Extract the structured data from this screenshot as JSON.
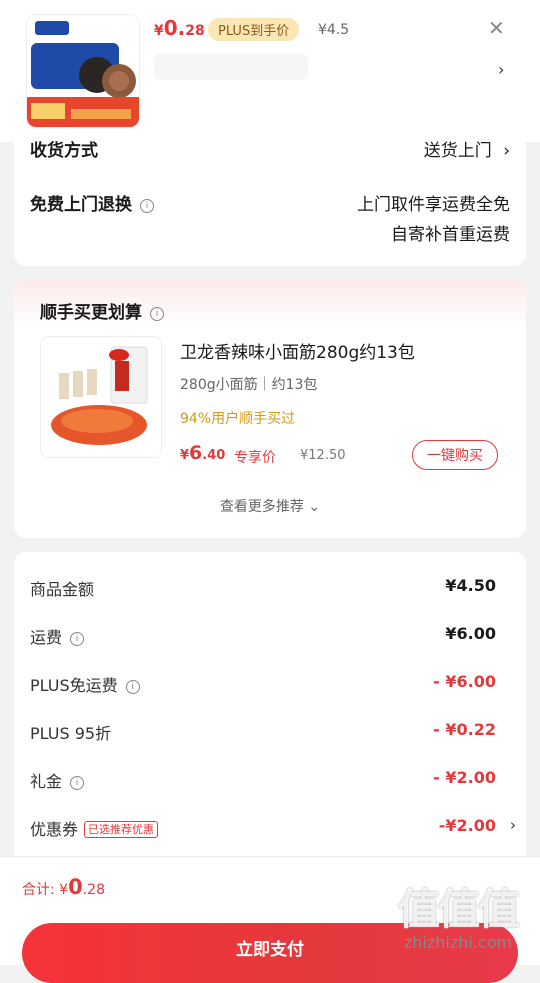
{
  "header": {
    "currency": "¥",
    "price_int": "0.",
    "price_dec": "28",
    "plus_badge": "PLUS到手价",
    "orig_price": "¥4.5",
    "close": "✕",
    "chevron": "›"
  },
  "delivery": {
    "method_label": "收货方式",
    "method_value": "送货上门",
    "return_label": "免费上门退换",
    "return_value_1": "上门取件享运费全免",
    "return_value_2": "自寄补首重运费",
    "chevron": "›"
  },
  "recommend": {
    "title": "顺手买更划算",
    "product_name": "卫龙香辣味小面筋280g约13包",
    "product_spec": "280g小面筋｜约13包",
    "tip": "94%用户顺手买过",
    "currency": "¥",
    "price_big": "6",
    "price_dec": ".40",
    "price_tag": "专享价",
    "orig_price": "¥12.50",
    "buy_label": "一键购买",
    "more_label": "查看更多推荐 ⌄"
  },
  "price_detail": {
    "rows": [
      {
        "label": "商品金额",
        "value": "¥4.50",
        "color": "#1a1a1a"
      },
      {
        "label": "运费",
        "value": "¥6.00",
        "color": "#1a1a1a"
      },
      {
        "label": "PLUS免运费",
        "value": "- ¥6.00",
        "color": "#e4393c"
      },
      {
        "label": "PLUS 95折",
        "value": "- ¥0.22",
        "color": "#e4393c"
      },
      {
        "label": "礼金",
        "value": "- ¥2.00",
        "color": "#e4393c"
      },
      {
        "label": "优惠券",
        "value": "-¥2.00",
        "color": "#e4393c"
      }
    ],
    "coupon_tag": "已选推荐优惠",
    "chevron": "›"
  },
  "bottom": {
    "total_label": "合计:",
    "currency": "¥",
    "total_big": "0",
    "total_dec": ".28",
    "pay_label": "立即支付"
  },
  "watermark": {
    "big": "值值值",
    "small": "zhizhizhi.com"
  },
  "colors": {
    "accent": "#e4393c",
    "plus_gold": "#fbe6b5",
    "tip": "#d39a1a"
  },
  "icons": [
    "close-icon",
    "chevron-right-icon",
    "info-icon",
    "chevron-down-icon"
  ]
}
